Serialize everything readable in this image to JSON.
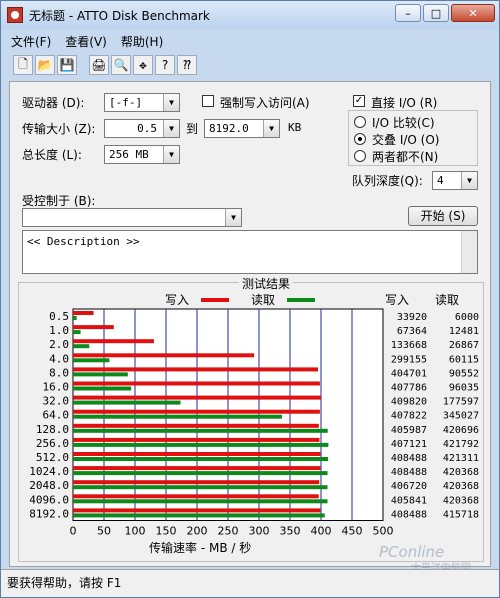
{
  "window": {
    "title": "无标题 - ATTO Disk Benchmark",
    "min_label": "–",
    "max_label": "□",
    "close_label": "✕"
  },
  "menu": [
    "文件(F)",
    "查看(V)",
    "帮助(H)"
  ],
  "toolbar": {
    "icons": [
      "new-icon",
      "open-icon",
      "save-icon",
      "print-icon",
      "print-preview-icon",
      "move-icon",
      "help-icon",
      "context-help-icon"
    ],
    "glyphs": [
      "🗋",
      "📂",
      "💾",
      "🖨",
      "🔍",
      "✥",
      "?",
      "⁇"
    ]
  },
  "form": {
    "drive_label": "驱动器 (D):",
    "drive_value": "[-f-]",
    "force_write_label": "强制写入访问(A)",
    "transfer_label": "传输大小 (Z):",
    "transfer_from": "0.5",
    "to_label": "到",
    "transfer_to": "8192.0",
    "kb_label": "KB",
    "length_label": "总长度 (L):",
    "length_value": "256 MB",
    "direct_io_label": "直接 I/O (R)",
    "radio_compare": "I/O 比较(C)",
    "radio_overlap": "交叠 I/O (O)",
    "radio_neither": "两者都不(N)",
    "queue_label": "队列深度(Q):",
    "queue_value": "4",
    "controlled_label": "受控制于 (B):",
    "controlled_value": "",
    "start_label": "开始 (S)",
    "description": "<< Description >>"
  },
  "results": {
    "title": "测试结果",
    "legend_write": "写入",
    "legend_read": "读取",
    "col_write": "写入",
    "col_read": "读取",
    "xlabel": "传输速率 - MB / 秒"
  },
  "colors": {
    "write": "#e01010",
    "read": "#0e8a1c",
    "grid": "#1b2a9c"
  },
  "chart_data": {
    "type": "bar",
    "title": "测试结果",
    "categories": [
      "0.5",
      "1.0",
      "2.0",
      "4.0",
      "8.0",
      "16.0",
      "32.0",
      "64.0",
      "128.0",
      "256.0",
      "512.0",
      "1024.0",
      "2048.0",
      "4096.0",
      "8192.0"
    ],
    "series": [
      {
        "name": "写入",
        "values": [
          33920,
          67364,
          133668,
          299155,
          404701,
          407786,
          409820,
          407822,
          405987,
          407121,
          408488,
          408488,
          406720,
          405841,
          408488
        ]
      },
      {
        "name": "读取",
        "values": [
          6000,
          12481,
          26867,
          60115,
          90552,
          96035,
          177597,
          345027,
          420696,
          421792,
          421311,
          420368,
          420368,
          420368,
          415718
        ]
      }
    ],
    "xlabel": "传输速率 - MB / 秒",
    "xlim": [
      0,
      500
    ],
    "xticks": [
      0,
      50,
      100,
      150,
      200,
      250,
      300,
      350,
      400,
      450,
      500
    ],
    "legend": "top"
  },
  "status": "要获得帮助，请按 F1",
  "watermark": {
    "brand": "PConline",
    "sub": "太平洋电脑网"
  }
}
